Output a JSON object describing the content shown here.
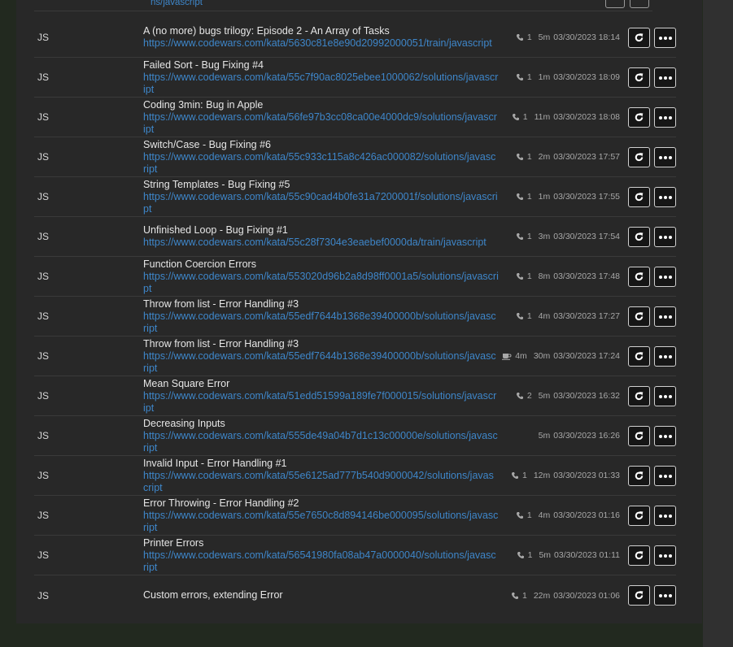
{
  "top_partial": {
    "url_tail": "ns/javascript"
  },
  "rows": [
    {
      "lang": "JS",
      "title": "A (no more) bugs trilogy: Episode 2 - An Array of Tasks",
      "url": "https://www.codewars.com/kata/5630c81e8e90d20992000051/train/javascript",
      "stat_icon": "phone",
      "stat": "1",
      "duration": "5m",
      "timestamp": "03/30/2023 18:14"
    },
    {
      "lang": "JS",
      "title": "Failed Sort - Bug Fixing #4",
      "url": "https://www.codewars.com/kata/55c7f90ac8025ebee1000062/solutions/javascript",
      "stat_icon": "phone",
      "stat": "1",
      "duration": "1m",
      "timestamp": "03/30/2023 18:09"
    },
    {
      "lang": "JS",
      "title": "Coding 3min: Bug in Apple",
      "url": "https://www.codewars.com/kata/56fe97b3cc08ca00e4000dc9/solutions/javascript",
      "stat_icon": "phone",
      "stat": "1",
      "duration": "11m",
      "timestamp": "03/30/2023 18:08"
    },
    {
      "lang": "JS",
      "title": "Switch/Case - Bug Fixing #6",
      "url": "https://www.codewars.com/kata/55c933c115a8c426ac000082/solutions/javascript",
      "stat_icon": "phone",
      "stat": "1",
      "duration": "2m",
      "timestamp": "03/30/2023 17:57"
    },
    {
      "lang": "JS",
      "title": "String Templates - Bug Fixing #5",
      "url": "https://www.codewars.com/kata/55c90cad4b0fe31a7200001f/solutions/javascript",
      "stat_icon": "phone",
      "stat": "1",
      "duration": "1m",
      "timestamp": "03/30/2023 17:55"
    },
    {
      "lang": "JS",
      "title": "Unfinished Loop - Bug Fixing #1",
      "url": "https://www.codewars.com/kata/55c28f7304e3eaebef0000da/train/javascript",
      "stat_icon": "phone",
      "stat": "1",
      "duration": "3m",
      "timestamp": "03/30/2023 17:54"
    },
    {
      "lang": "JS",
      "title": "Function Coercion Errors",
      "url": "https://www.codewars.com/kata/553020d96b2a8d98ff0001a5/solutions/javascript",
      "stat_icon": "phone",
      "stat": "1",
      "duration": "8m",
      "timestamp": "03/30/2023 17:48"
    },
    {
      "lang": "JS",
      "title": "Throw from list - Error Handling #3",
      "url": "https://www.codewars.com/kata/55edf7644b1368e39400000b/solutions/javascript",
      "stat_icon": "phone",
      "stat": "1",
      "duration": "4m",
      "timestamp": "03/30/2023 17:27"
    },
    {
      "lang": "JS",
      "title": "Throw from list - Error Handling #3",
      "url": "https://www.codewars.com/kata/55edf7644b1368e39400000b/solutions/javascript",
      "stat_icon": "coffee",
      "stat": "4m",
      "duration": "30m",
      "timestamp": "03/30/2023 17:24"
    },
    {
      "lang": "JS",
      "title": "Mean Square Error",
      "url": "https://www.codewars.com/kata/51edd51599a189fe7f000015/solutions/javascript",
      "stat_icon": "phone",
      "stat": "2",
      "duration": "5m",
      "timestamp": "03/30/2023 16:32"
    },
    {
      "lang": "JS",
      "title": "Decreasing Inputs",
      "url": "https://www.codewars.com/kata/555de49a04b7d1c13c00000e/solutions/javascript",
      "stat_icon": "",
      "stat": "",
      "duration": "5m",
      "timestamp": "03/30/2023 16:26"
    },
    {
      "lang": "JS",
      "title": "Invalid Input - Error Handling #1",
      "url": "https://www.codewars.com/kata/55e6125ad777b540d9000042/solutions/javascript",
      "stat_icon": "phone",
      "stat": "1",
      "duration": "12m",
      "timestamp": "03/30/2023 01:33"
    },
    {
      "lang": "JS",
      "title": "Error Throwing - Error Handling #2",
      "url": "https://www.codewars.com/kata/55e7650c8d894146be000095/solutions/javascript",
      "stat_icon": "phone",
      "stat": "1",
      "duration": "4m",
      "timestamp": "03/30/2023 01:16"
    },
    {
      "lang": "JS",
      "title": "Printer Errors",
      "url": "https://www.codewars.com/kata/56541980fa08ab47a0000040/solutions/javascript",
      "stat_icon": "phone",
      "stat": "1",
      "duration": "5m",
      "timestamp": "03/30/2023 01:11"
    },
    {
      "lang": "JS",
      "title": "Custom errors, extending Error",
      "url": "",
      "stat_icon": "phone",
      "stat": "1",
      "duration": "22m",
      "timestamp": "03/30/2023 01:06"
    }
  ],
  "colors": {
    "link": "#3e86c9",
    "panel": "#282828",
    "page": "#22291f"
  }
}
